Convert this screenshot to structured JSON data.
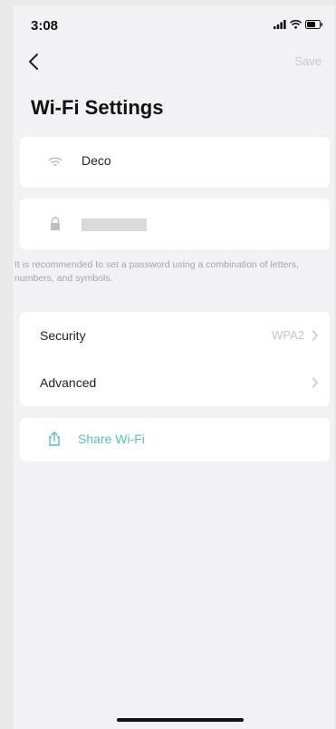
{
  "status_bar": {
    "time": "3:08",
    "icons": [
      "cellular-signal-icon",
      "wifi-icon",
      "battery-icon"
    ]
  },
  "nav": {
    "back_icon": "chevron-left-icon",
    "save_label": "Save"
  },
  "page": {
    "title": "Wi-Fi Settings"
  },
  "network": {
    "ssid_icon": "wifi-icon",
    "ssid": "Deco",
    "password_icon": "lock-icon",
    "password_hint": "It is recommended to set a password using a combination of letters, numbers, and symbols."
  },
  "settings": {
    "items": [
      {
        "label": "Security",
        "value": "WPA2",
        "icon": "chevron-right-icon"
      },
      {
        "label": "Advanced",
        "value": "",
        "icon": "chevron-right-icon"
      }
    ]
  },
  "share": {
    "icon": "share-icon",
    "label": "Share Wi-Fi"
  },
  "colors": {
    "accent": "#4cc5be",
    "background": "#f2f2f4",
    "card": "#ffffff",
    "muted_text": "#a5a5aa"
  }
}
